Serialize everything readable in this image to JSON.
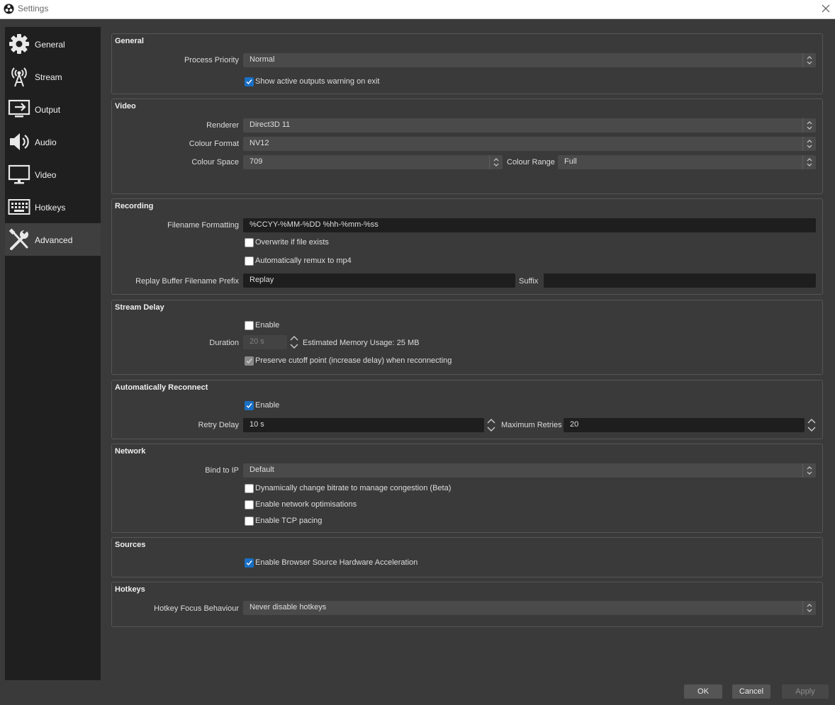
{
  "window": {
    "title": "Settings",
    "app_icon": "obs-logo-icon"
  },
  "sidebar": {
    "items": [
      {
        "label": "General",
        "icon": "gear-icon"
      },
      {
        "label": "Stream",
        "icon": "antenna-icon"
      },
      {
        "label": "Output",
        "icon": "monitor-output-icon"
      },
      {
        "label": "Audio",
        "icon": "speaker-icon"
      },
      {
        "label": "Video",
        "icon": "monitor-icon"
      },
      {
        "label": "Hotkeys",
        "icon": "keyboard-icon"
      },
      {
        "label": "Advanced",
        "icon": "tools-icon"
      }
    ],
    "selected": "Advanced"
  },
  "general": {
    "title": "General",
    "process_priority_label": "Process Priority",
    "process_priority_value": "Normal",
    "show_warning_label": "Show active outputs warning on exit",
    "show_warning_checked": true
  },
  "video": {
    "title": "Video",
    "renderer_label": "Renderer",
    "renderer_value": "Direct3D 11",
    "colour_format_label": "Colour Format",
    "colour_format_value": "NV12",
    "colour_space_label": "Colour Space",
    "colour_space_value": "709",
    "colour_range_label": "Colour Range",
    "colour_range_value": "Full"
  },
  "recording": {
    "title": "Recording",
    "filename_label": "Filename Formatting",
    "filename_value": "%CCYY-%MM-%DD %hh-%mm-%ss",
    "overwrite_label": "Overwrite if file exists",
    "overwrite_checked": false,
    "remux_label": "Automatically remux to mp4",
    "remux_checked": false,
    "replay_prefix_label": "Replay Buffer Filename Prefix",
    "replay_prefix_value": "Replay",
    "suffix_label": "Suffix",
    "suffix_value": ""
  },
  "stream_delay": {
    "title": "Stream Delay",
    "enable_label": "Enable",
    "enable_checked": false,
    "duration_label": "Duration",
    "duration_value": "20 s",
    "memory_usage": "Estimated Memory Usage: 25 MB",
    "preserve_label": "Preserve cutoff point (increase delay) when reconnecting",
    "preserve_checked": true
  },
  "reconnect": {
    "title": "Automatically Reconnect",
    "enable_label": "Enable",
    "enable_checked": true,
    "retry_delay_label": "Retry Delay",
    "retry_delay_value": "10 s",
    "max_retries_label": "Maximum Retries",
    "max_retries_value": "20"
  },
  "network": {
    "title": "Network",
    "bind_label": "Bind to IP",
    "bind_value": "Default",
    "dynamic_bitrate_label": "Dynamically change bitrate to manage congestion (Beta)",
    "dynamic_bitrate_checked": false,
    "optimisations_label": "Enable network optimisations",
    "optimisations_checked": false,
    "tcp_pacing_label": "Enable TCP pacing",
    "tcp_pacing_checked": false
  },
  "sources": {
    "title": "Sources",
    "browser_accel_label": "Enable Browser Source Hardware Acceleration",
    "browser_accel_checked": true
  },
  "hotkeys": {
    "title": "Hotkeys",
    "focus_label": "Hotkey Focus Behaviour",
    "focus_value": "Never disable hotkeys"
  },
  "buttons": {
    "ok": "OK",
    "cancel": "Cancel",
    "apply": "Apply"
  },
  "colors": {
    "accent": "#1a6fc4",
    "background": "#3a3a3a",
    "sidebar": "#1f1f1f",
    "selected_item": "#3f3f3f"
  }
}
